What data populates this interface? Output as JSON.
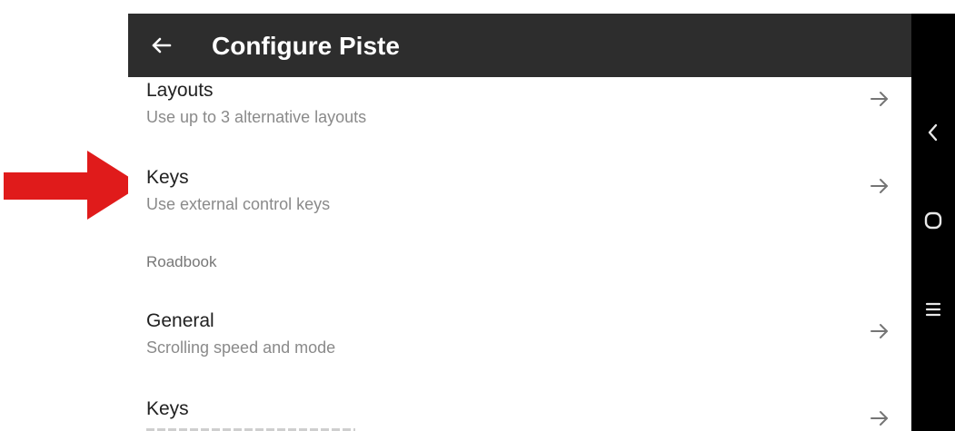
{
  "appbar": {
    "title": "Configure Piste",
    "back_icon": "arrow-left-icon"
  },
  "settings": {
    "items": [
      {
        "title": "Layouts",
        "subtitle": "Use up to 3 alternative layouts",
        "icon": "arrow-right-icon"
      },
      {
        "title": "Keys",
        "subtitle": "Use external control keys",
        "icon": "arrow-right-icon"
      }
    ],
    "section": "Roadbook",
    "section_items": [
      {
        "title": "General",
        "subtitle": "Scrolling speed and mode",
        "icon": "arrow-right-icon"
      },
      {
        "title": "Keys",
        "subtitle": "",
        "icon": "arrow-right-icon"
      }
    ]
  },
  "system_nav": {
    "buttons": [
      "back-chevron-icon",
      "home-circle-icon",
      "recents-menu-icon"
    ]
  },
  "annotation": {
    "icon": "red-pointer-arrow-icon",
    "color": "#e01b1b"
  },
  "colors": {
    "appbar_bg": "#2d2d2d",
    "navbar_bg": "#000000",
    "title_text": "#212121",
    "subtitle_text": "#8a8a8a",
    "arrow_icon": "#757575"
  }
}
